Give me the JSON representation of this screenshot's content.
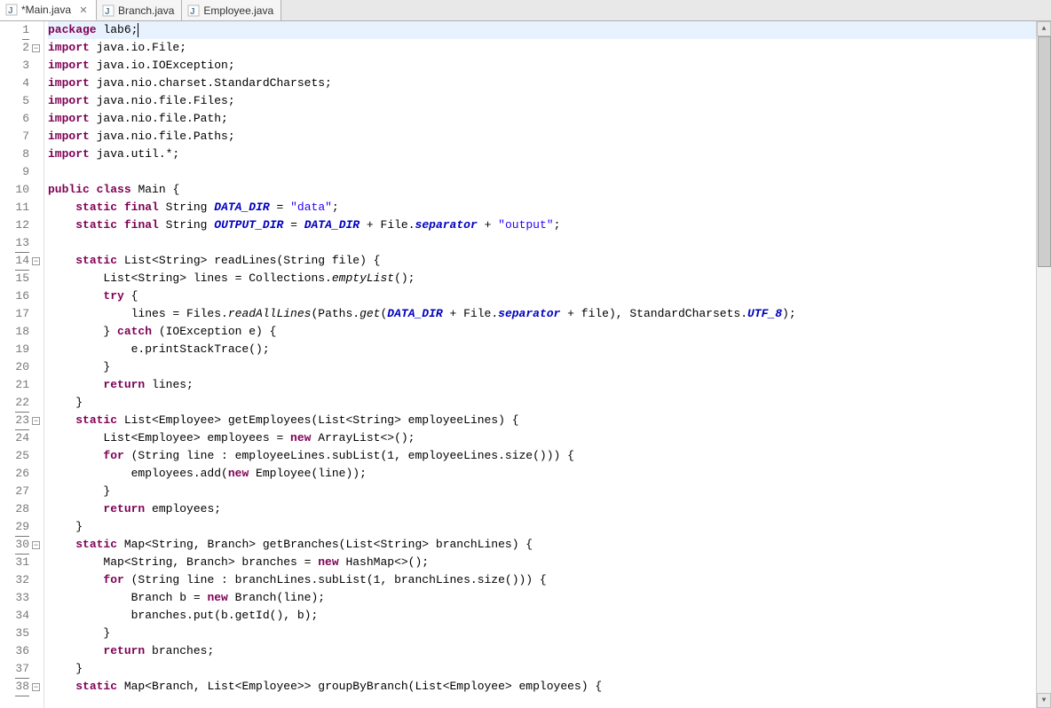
{
  "tabs": [
    {
      "label": "*Main.java",
      "active": true,
      "closeable": true
    },
    {
      "label": "Branch.java",
      "active": false,
      "closeable": false
    },
    {
      "label": "Employee.java",
      "active": false,
      "closeable": false
    }
  ],
  "gutter": [
    {
      "num": "1",
      "under": true
    },
    {
      "num": "2",
      "fold": true
    },
    {
      "num": "3"
    },
    {
      "num": "4"
    },
    {
      "num": "5"
    },
    {
      "num": "6"
    },
    {
      "num": "7"
    },
    {
      "num": "8"
    },
    {
      "num": "9"
    },
    {
      "num": "10"
    },
    {
      "num": "11"
    },
    {
      "num": "12"
    },
    {
      "num": "13",
      "under": true
    },
    {
      "num": "14",
      "fold": true,
      "under": true
    },
    {
      "num": "15"
    },
    {
      "num": "16"
    },
    {
      "num": "17"
    },
    {
      "num": "18"
    },
    {
      "num": "19"
    },
    {
      "num": "20"
    },
    {
      "num": "21"
    },
    {
      "num": "22",
      "under": true
    },
    {
      "num": "23",
      "fold": true,
      "under": true
    },
    {
      "num": "24"
    },
    {
      "num": "25"
    },
    {
      "num": "26"
    },
    {
      "num": "27"
    },
    {
      "num": "28"
    },
    {
      "num": "29",
      "under": true
    },
    {
      "num": "30",
      "fold": true,
      "under": true
    },
    {
      "num": "31"
    },
    {
      "num": "32"
    },
    {
      "num": "33"
    },
    {
      "num": "34"
    },
    {
      "num": "35"
    },
    {
      "num": "36"
    },
    {
      "num": "37",
      "under": true
    },
    {
      "num": "38",
      "fold": true,
      "under": true
    }
  ],
  "code": [
    {
      "current": true,
      "tokens": [
        {
          "t": "package",
          "k": true
        },
        {
          "t": " lab6;"
        }
      ],
      "cursor": true
    },
    {
      "tokens": [
        {
          "t": "import",
          "k": true
        },
        {
          "t": " java.io.File;"
        }
      ]
    },
    {
      "tokens": [
        {
          "t": "import",
          "k": true
        },
        {
          "t": " java.io.IOException;"
        }
      ]
    },
    {
      "tokens": [
        {
          "t": "import",
          "k": true
        },
        {
          "t": " java.nio.charset.StandardCharsets;"
        }
      ]
    },
    {
      "tokens": [
        {
          "t": "import",
          "k": true
        },
        {
          "t": " java.nio.file.Files;"
        }
      ]
    },
    {
      "tokens": [
        {
          "t": "import",
          "k": true
        },
        {
          "t": " java.nio.file.Path;"
        }
      ]
    },
    {
      "tokens": [
        {
          "t": "import",
          "k": true
        },
        {
          "t": " java.nio.file.Paths;"
        }
      ]
    },
    {
      "tokens": [
        {
          "t": "import",
          "k": true
        },
        {
          "t": " java.util.*;"
        }
      ]
    },
    {
      "tokens": []
    },
    {
      "tokens": [
        {
          "t": "public",
          "k": true
        },
        {
          "t": " "
        },
        {
          "t": "class",
          "k": true
        },
        {
          "t": " Main {"
        }
      ]
    },
    {
      "tokens": [
        {
          "t": "    "
        },
        {
          "t": "static",
          "k": true
        },
        {
          "t": " "
        },
        {
          "t": "final",
          "k": true
        },
        {
          "t": " String "
        },
        {
          "t": "DATA_DIR",
          "si": true
        },
        {
          "t": " = "
        },
        {
          "t": "\"data\"",
          "s": true
        },
        {
          "t": ";"
        }
      ]
    },
    {
      "tokens": [
        {
          "t": "    "
        },
        {
          "t": "static",
          "k": true
        },
        {
          "t": " "
        },
        {
          "t": "final",
          "k": true
        },
        {
          "t": " String "
        },
        {
          "t": "OUTPUT_DIR",
          "si": true
        },
        {
          "t": " = "
        },
        {
          "t": "DATA_DIR",
          "si": true
        },
        {
          "t": " + File."
        },
        {
          "t": "separator",
          "si": true
        },
        {
          "t": " + "
        },
        {
          "t": "\"output\"",
          "s": true
        },
        {
          "t": ";"
        }
      ]
    },
    {
      "tokens": []
    },
    {
      "tokens": [
        {
          "t": "    "
        },
        {
          "t": "static",
          "k": true
        },
        {
          "t": " List<String> readLines(String file) {"
        }
      ]
    },
    {
      "tokens": [
        {
          "t": "        List<String> lines = Collections."
        },
        {
          "t": "emptyList",
          "fi": true
        },
        {
          "t": "();"
        }
      ]
    },
    {
      "tokens": [
        {
          "t": "        "
        },
        {
          "t": "try",
          "k": true
        },
        {
          "t": " {"
        }
      ]
    },
    {
      "tokens": [
        {
          "t": "            lines = Files."
        },
        {
          "t": "readAllLines",
          "fi": true
        },
        {
          "t": "(Paths."
        },
        {
          "t": "get",
          "fi": true
        },
        {
          "t": "("
        },
        {
          "t": "DATA_DIR",
          "si": true
        },
        {
          "t": " + File."
        },
        {
          "t": "separator",
          "si": true
        },
        {
          "t": " + file), StandardCharsets."
        },
        {
          "t": "UTF_8",
          "si": true
        },
        {
          "t": ");"
        }
      ]
    },
    {
      "tokens": [
        {
          "t": "        } "
        },
        {
          "t": "catch",
          "k": true
        },
        {
          "t": " (IOException e) {"
        }
      ]
    },
    {
      "tokens": [
        {
          "t": "            e.printStackTrace();"
        }
      ]
    },
    {
      "tokens": [
        {
          "t": "        }"
        }
      ]
    },
    {
      "tokens": [
        {
          "t": "        "
        },
        {
          "t": "return",
          "k": true
        },
        {
          "t": " lines;"
        }
      ]
    },
    {
      "tokens": [
        {
          "t": "    }"
        }
      ]
    },
    {
      "tokens": [
        {
          "t": "    "
        },
        {
          "t": "static",
          "k": true
        },
        {
          "t": " List<Employee> getEmployees(List<String> employeeLines) {"
        }
      ]
    },
    {
      "tokens": [
        {
          "t": "        List<Employee> employees = "
        },
        {
          "t": "new",
          "k": true
        },
        {
          "t": " ArrayList<>();"
        }
      ]
    },
    {
      "tokens": [
        {
          "t": "        "
        },
        {
          "t": "for",
          "k": true
        },
        {
          "t": " (String line : employeeLines.subList(1, employeeLines.size())) {"
        }
      ]
    },
    {
      "tokens": [
        {
          "t": "            employees.add("
        },
        {
          "t": "new",
          "k": true
        },
        {
          "t": " Employee(line));"
        }
      ]
    },
    {
      "tokens": [
        {
          "t": "        }"
        }
      ]
    },
    {
      "tokens": [
        {
          "t": "        "
        },
        {
          "t": "return",
          "k": true
        },
        {
          "t": " employees;"
        }
      ]
    },
    {
      "tokens": [
        {
          "t": "    }"
        }
      ]
    },
    {
      "tokens": [
        {
          "t": "    "
        },
        {
          "t": "static",
          "k": true
        },
        {
          "t": " Map<String, Branch> getBranches(List<String> branchLines) {"
        }
      ]
    },
    {
      "tokens": [
        {
          "t": "        Map<String, Branch> branches = "
        },
        {
          "t": "new",
          "k": true
        },
        {
          "t": " HashMap<>();"
        }
      ]
    },
    {
      "tokens": [
        {
          "t": "        "
        },
        {
          "t": "for",
          "k": true
        },
        {
          "t": " (String line : branchLines.subList(1, branchLines.size())) {"
        }
      ]
    },
    {
      "tokens": [
        {
          "t": "            Branch b = "
        },
        {
          "t": "new",
          "k": true
        },
        {
          "t": " Branch(line);"
        }
      ]
    },
    {
      "tokens": [
        {
          "t": "            branches.put(b.getId(), b);"
        }
      ]
    },
    {
      "tokens": [
        {
          "t": "        }"
        }
      ]
    },
    {
      "tokens": [
        {
          "t": "        "
        },
        {
          "t": "return",
          "k": true
        },
        {
          "t": " branches;"
        }
      ]
    },
    {
      "tokens": [
        {
          "t": "    }"
        }
      ]
    },
    {
      "tokens": [
        {
          "t": "    "
        },
        {
          "t": "static",
          "k": true
        },
        {
          "t": " Map<Branch, List<Employee>> groupByBranch(List<Employee> employees) {"
        }
      ]
    }
  ]
}
